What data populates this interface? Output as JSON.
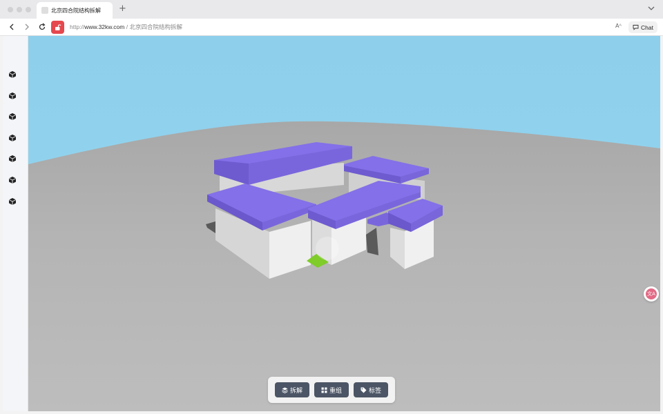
{
  "browser": {
    "tab_title": "北京四合院结构拆解",
    "new_tab_label": "+",
    "url_scheme": "http://",
    "url_host": "www.32kw.com",
    "url_path": " / 北京四合院结构拆解",
    "chat_label": "Chat",
    "read_aloud_label": "Aᴬ"
  },
  "sidebar": {
    "tools": [
      {
        "icon": "cube-icon"
      },
      {
        "icon": "cube-icon"
      },
      {
        "icon": "cube-icon"
      },
      {
        "icon": "cube-icon"
      },
      {
        "icon": "cube-icon"
      },
      {
        "icon": "cube-icon"
      },
      {
        "icon": "cube-icon"
      }
    ]
  },
  "toolbar": {
    "disassemble_label": "拆解",
    "reassemble_label": "重组",
    "labels_label": "标签"
  },
  "colors": {
    "sky": "#8fd0ec",
    "ground": "#b3b3b3",
    "roof": "#8470e8",
    "wall": "#e6e6e6",
    "button": "#4b5565",
    "accent": "#e5484d"
  }
}
